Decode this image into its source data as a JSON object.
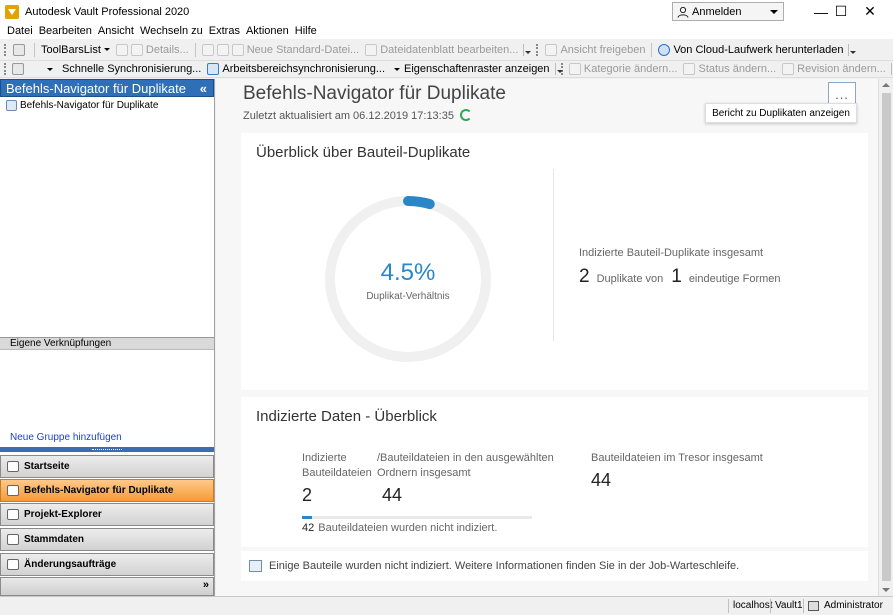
{
  "window": {
    "title": "Autodesk Vault Professional 2020",
    "signin_label": "Anmelden",
    "minimize": "—",
    "maximize": "☐",
    "close": "✕"
  },
  "menubar": {
    "items": [
      "Datei",
      "Bearbeiten",
      "Ansicht",
      "Wechseln zu",
      "Extras",
      "Aktionen",
      "Hilfe"
    ]
  },
  "toolbar1": {
    "toolbarslist": "ToolBarsList",
    "details": "Details...",
    "new_std_file": "Neue Standard-Datei...",
    "datasheet": "Dateidatenblatt bearbeiten...",
    "share_view": "Ansicht freigeben",
    "cloud_download": "Von Cloud-Laufwerk herunterladen"
  },
  "toolbar2": {
    "quick_sync": "Schnelle Synchronisierung...",
    "workspace_sync": "Arbeitsbereichsynchronisierung...",
    "show_grid": "Eigenschaftenraster anzeigen",
    "change_category": "Kategorie ändern...",
    "change_status": "Status ändern...",
    "change_revision": "Revision ändern..."
  },
  "leftpane": {
    "header": "Befehls-Navigator für Duplikate",
    "collapse_glyph": "«",
    "tree_item": "Befehls-Navigator für Duplikate",
    "shortcuts_header": "Eigene Verknüpfungen",
    "add_group": "Neue Gruppe hinzufügen",
    "nav_buttons": [
      {
        "label": "Startseite"
      },
      {
        "label": "Befehls-Navigator für Duplikate"
      },
      {
        "label": "Projekt-Explorer"
      },
      {
        "label": "Stammdaten"
      },
      {
        "label": "Änderungsaufträge"
      }
    ],
    "footer_glyph": "»"
  },
  "main": {
    "title": "Befehls-Navigator für Duplikate",
    "updated": "Zuletzt aktualisiert am 06.12.2019 17:13:35",
    "more_glyph": "...",
    "tooltip": "Bericht zu Duplikaten anzeigen",
    "overview": {
      "title": "Überblick über Bauteil-Duplikate",
      "ratio_value": "4.5%",
      "ratio_fraction": 0.045,
      "ratio_label": "Duplikat-Verhältnis",
      "total_label": "Indizierte Bauteil-Duplikate insgesamt",
      "dup_count": "2",
      "dup_of_label": "Duplikate von",
      "unique_count": "1",
      "unique_label": "eindeutige Formen"
    },
    "indexed": {
      "title": "Indizierte Daten - Überblick",
      "indexed_label": "Indizierte Bauteildateien",
      "indexed_value": "2",
      "selected_label": "/Bauteildateien in den ausgewählten Ordnern insgesamt",
      "selected_value": "44",
      "vault_label": "Bauteildateien im Tresor insgesamt",
      "vault_value": "44",
      "progress_fraction": 0.045,
      "not_indexed_count": "42",
      "not_indexed_label": "Bauteildateien wurden nicht indiziert."
    },
    "info_text": "Einige Bauteile wurden nicht indiziert. Weitere Informationen finden Sie in der Job-Warteschleife."
  },
  "statusbar": {
    "server": "localhost",
    "vault": "Vault1",
    "user": "Administrator"
  },
  "colors": {
    "accent": "#2a86c7",
    "nav_header": "#2e6fb7",
    "active_nav": "#f59b35",
    "refresh": "#2fa84f"
  }
}
